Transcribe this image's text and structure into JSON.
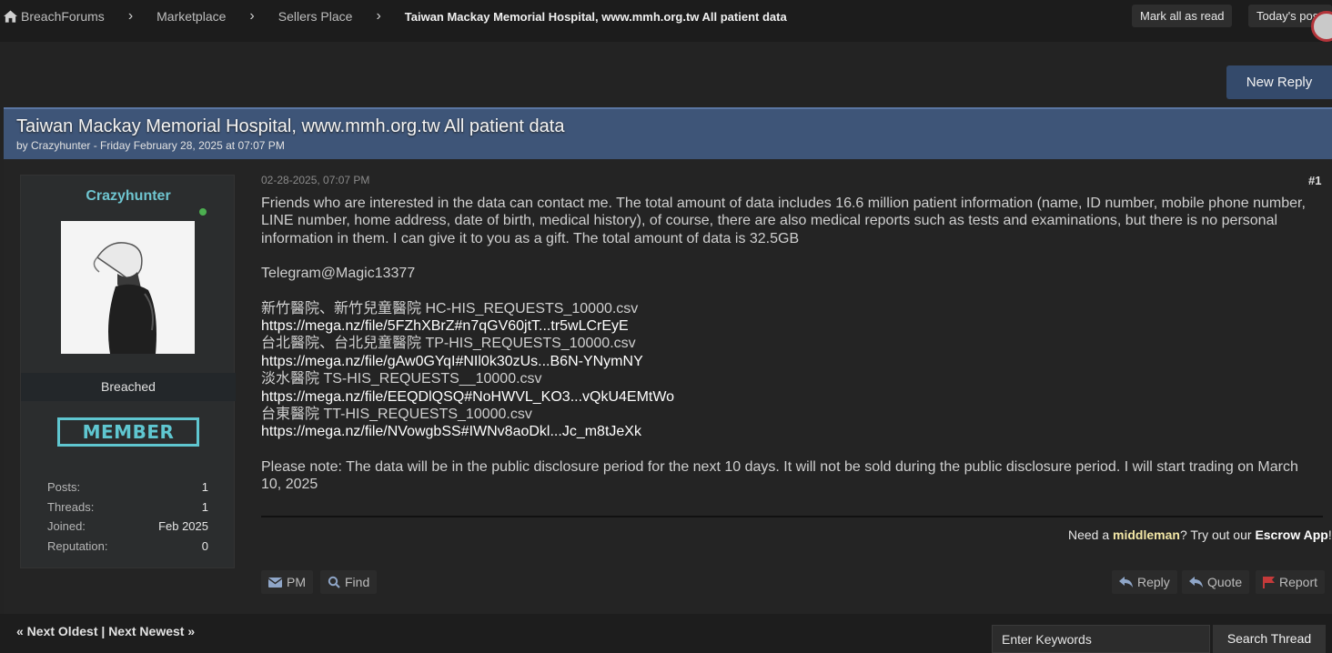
{
  "breadcrumb": {
    "items": [
      "BreachForums",
      "Marketplace",
      "Sellers Place"
    ],
    "current": "Taiwan Mackay Memorial Hospital, www.mmh.org.tw All patient data"
  },
  "topbar": {
    "mark_read": "Mark all as read",
    "todays_posts": "Today's posts"
  },
  "new_reply": "New Reply",
  "thread": {
    "title": "Taiwan Mackay Memorial Hospital, www.mmh.org.tw All patient data",
    "byline": "by Crazyhunter - Friday February 28, 2025 at 07:07 PM"
  },
  "user": {
    "name": "Crazyhunter",
    "group": "Breached",
    "badge": "MEMBER",
    "stats": [
      {
        "label": "Posts:",
        "value": "1"
      },
      {
        "label": "Threads:",
        "value": "1"
      },
      {
        "label": "Joined:",
        "value": "Feb 2025"
      },
      {
        "label": "Reputation:",
        "value": "0"
      }
    ]
  },
  "post": {
    "date": "02-28-2025, 07:07 PM",
    "number": "#1",
    "intro": "Friends who are interested in the data can contact me. The total amount of data includes 16.6 million patient information (name, ID number, mobile phone number, LINE number, home address, date of birth, medical history), of course, there are also medical reports such as tests and examinations, but there is no personal information in them. I can give it to you as a gift. The total amount of data is 32.5GB",
    "telegram": "Telegram@Magic13377",
    "files": [
      {
        "name": "新竹醫院、新竹兒童醫院 HC-HIS_REQUESTS_10000.csv",
        "link": "https://mega.nz/file/5FZhXBrZ#n7qGV60jtT...tr5wLCrEyE"
      },
      {
        "name": "台北醫院、台北兒童醫院 TP-HIS_REQUESTS_10000.csv",
        "link": "https://mega.nz/file/gAw0GYqI#NIl0k30zUs...B6N-YNymNY"
      },
      {
        "name": "淡水醫院 TS-HIS_REQUESTS__10000.csv",
        "link": "https://mega.nz/file/EEQDlQSQ#NoHWVL_KO3...vQkU4EMtWo"
      },
      {
        "name": "台東醫院 TT-HIS_REQUESTS_10000.csv",
        "link": "https://mega.nz/file/NVowgbSS#IWNv8aoDkl...Jc_m8tJeXk"
      }
    ],
    "note": "Please note: The data will be in the public disclosure period for the next 10 days. It will not be sold during the public disclosure period. I will start trading on March 10, 2025"
  },
  "escrow": {
    "part1": "Need a ",
    "middleman": "middleman",
    "part2": "? Try out our ",
    "app": "Escrow App",
    "part3": "!"
  },
  "buttons": {
    "pm": "PM",
    "find": "Find",
    "reply": "Reply",
    "quote": "Quote",
    "report": "Report"
  },
  "footer": {
    "next_oldest": "« Next Oldest",
    "sep": " | ",
    "next_newest": "Next Newest »",
    "search_placeholder": "Enter Keywords",
    "search_button": "Search Thread"
  },
  "colors": {
    "accent_blue": "#3e5578",
    "username_teal": "#6ec4cf",
    "online_green": "#4caf50",
    "report_red": "#c43a3a"
  }
}
